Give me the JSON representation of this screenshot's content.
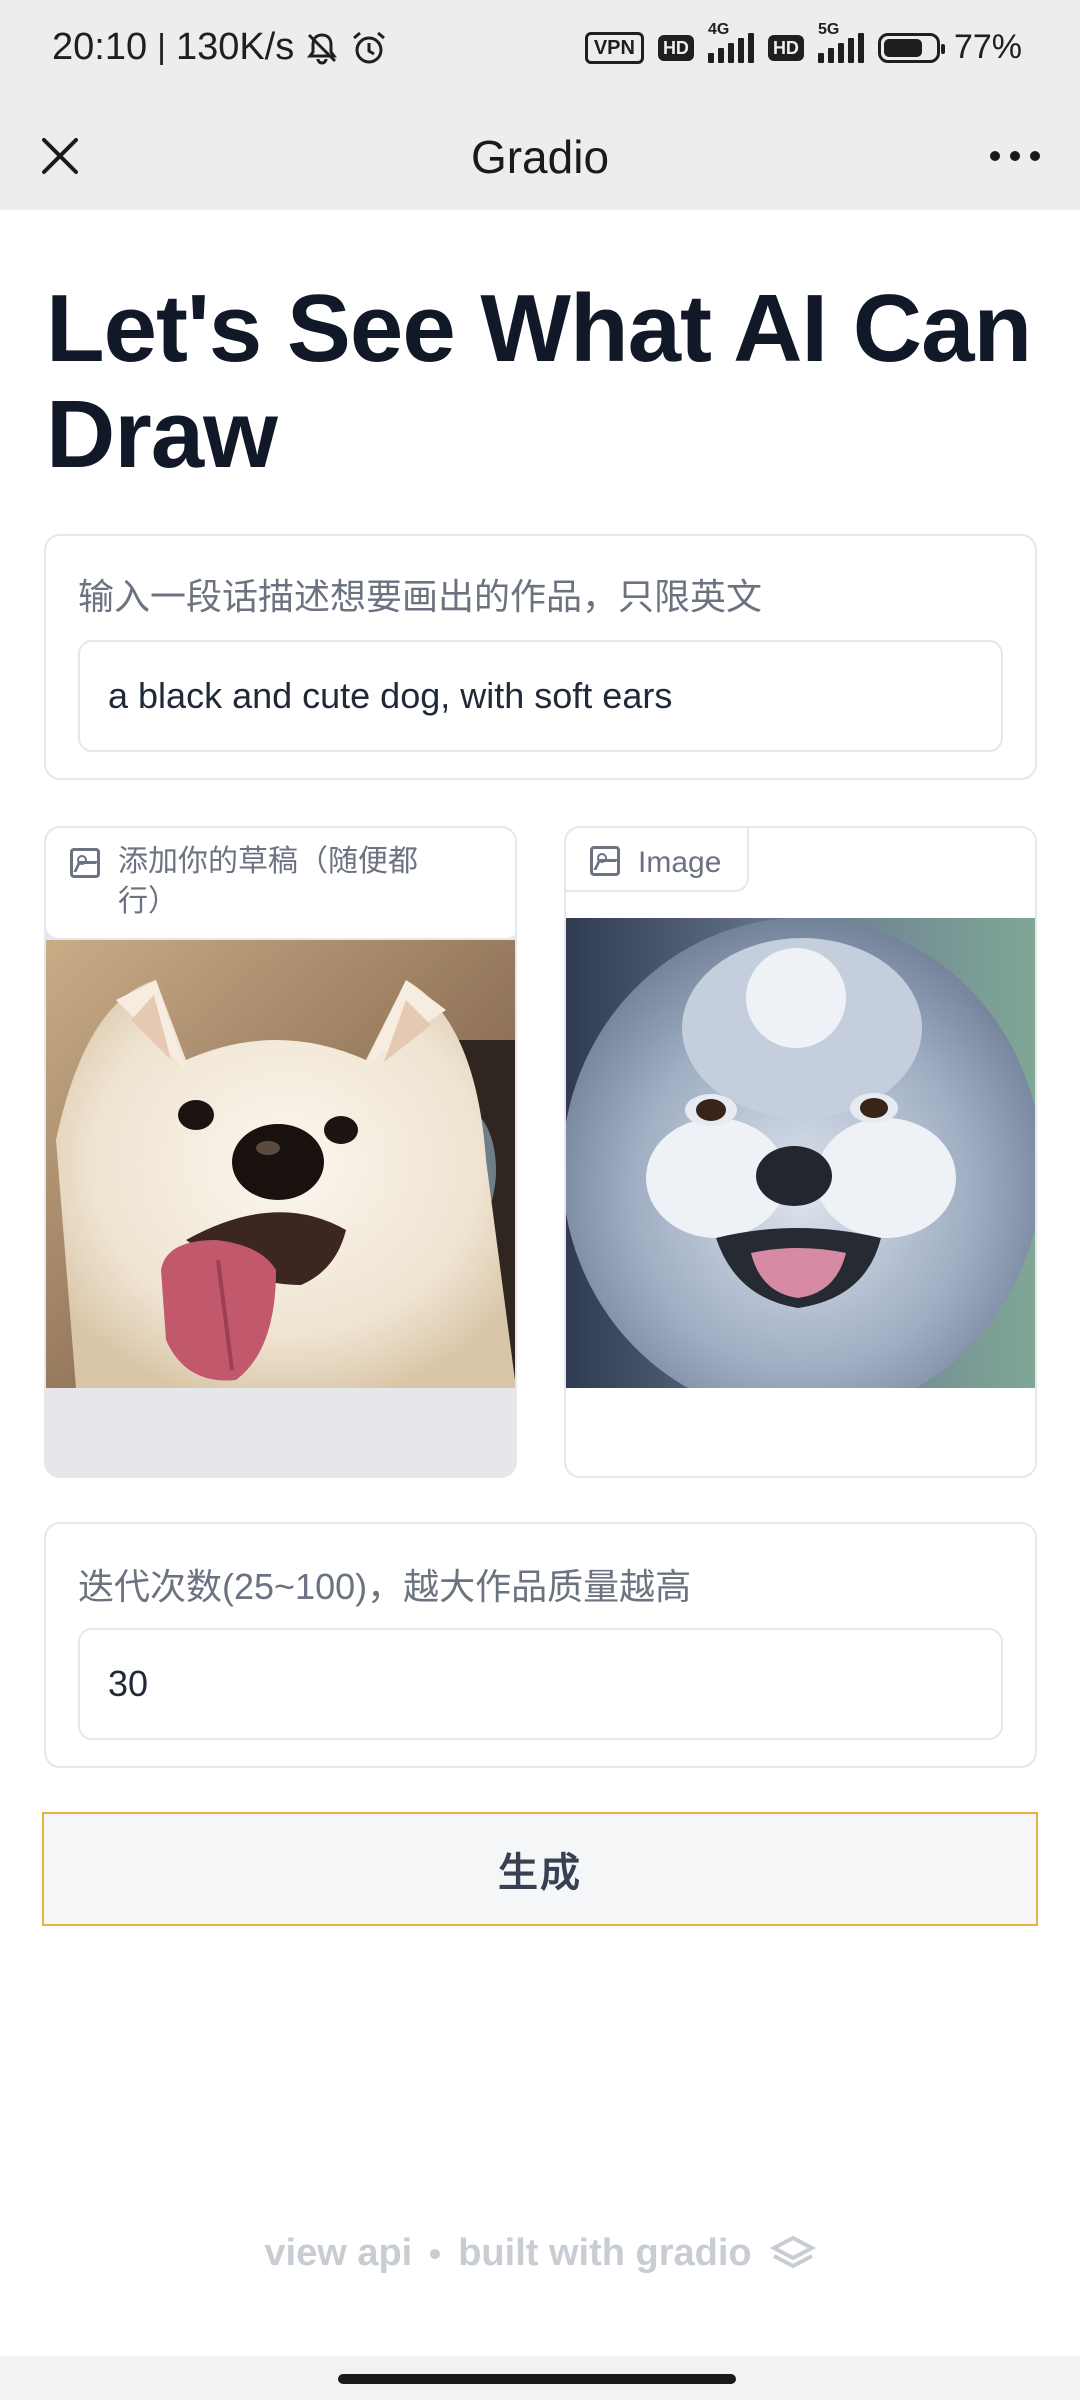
{
  "status_bar": {
    "time": "20:10",
    "speed": "130K/s",
    "vpn": "VPN",
    "hd1": "HD",
    "net1": "4G",
    "hd2": "HD",
    "net2": "5G",
    "battery": "77%"
  },
  "nav": {
    "title": "Gradio",
    "close_icon": "close-icon",
    "more_icon": "more-icon"
  },
  "page": {
    "title": "Let's See What AI Can Draw"
  },
  "prompt_block": {
    "label": "输入一段话描述想要画出的作品，只限英文",
    "value": "a black and cute dog, with soft ears"
  },
  "sketch_block": {
    "label": "添加你的草稿（随便都行）",
    "icon": "image-icon"
  },
  "output_block": {
    "label": "Image",
    "icon": "image-icon"
  },
  "steps_block": {
    "label": "迭代次数(25~100)，越大作品质量越高",
    "value": "30"
  },
  "generate_button": {
    "label": "生成"
  },
  "footer": {
    "view_api": "view api",
    "built_with": "built with gradio"
  },
  "colors": {
    "accent_border": "#e3b341",
    "title": "#111827",
    "muted": "#6b7280"
  }
}
